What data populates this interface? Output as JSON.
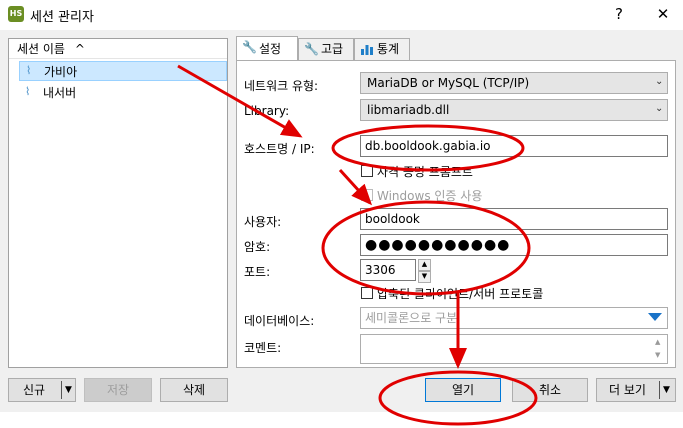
{
  "window": {
    "title": "세션 관리자",
    "icon_text": "HS",
    "help_icon": "?",
    "close_icon": "✕"
  },
  "sessions": {
    "column_header": "세션 이름",
    "sort_icon": "^",
    "items": [
      {
        "label": "가비아",
        "selected": true
      },
      {
        "label": "내서버",
        "selected": false
      }
    ]
  },
  "tabs": [
    {
      "label": "설정",
      "icon": "wrench-icon",
      "active": true
    },
    {
      "label": "고급",
      "icon": "wrench-orange-icon",
      "active": false
    },
    {
      "label": "통계",
      "icon": "bar-chart-icon",
      "active": false
    }
  ],
  "settings": {
    "network_type": {
      "label": "네트워크 유형:",
      "value": "MariaDB or MySQL (TCP/IP)"
    },
    "library": {
      "label": "Library:",
      "value": "libmariadb.dll"
    },
    "host": {
      "label": "호스트명 / IP:",
      "value": "db.booldook.gabia.io"
    },
    "ssl": {
      "label": "자격 증명 프롬프트"
    },
    "windows_auth": {
      "label": "Windows 인증 사용"
    },
    "user": {
      "label": "사용자:",
      "value": "booldook"
    },
    "password": {
      "label": "암호:",
      "value": "●●●●●●●●●●●"
    },
    "port": {
      "label": "포트:",
      "value": "3306"
    },
    "compression": {
      "label": "압축된 클라이언트/서버 프로토콜"
    },
    "databases": {
      "label": "데이터베이스:",
      "placeholder": "세미콜론으로 구분"
    },
    "comment": {
      "label": "코멘트:",
      "value": ""
    }
  },
  "buttons": {
    "new": "신규",
    "save": "저장",
    "delete": "삭제",
    "open": "열기",
    "cancel": "취소",
    "more": "더 보기"
  },
  "colors": {
    "annotation": "#e00000",
    "selection": "#cce8ff",
    "accent": "#0078d7"
  }
}
